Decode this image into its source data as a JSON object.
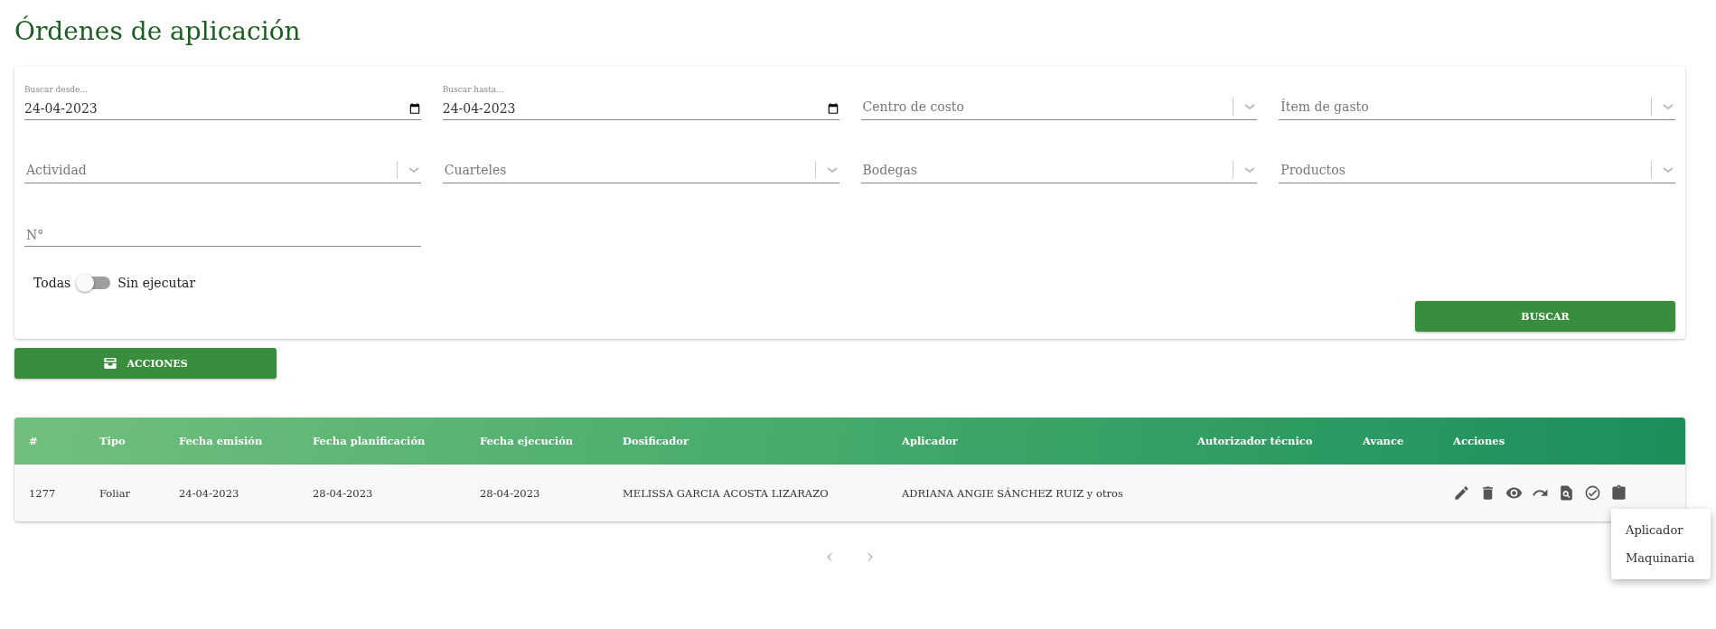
{
  "page_title": "Órdenes de aplicación",
  "filters": [
    {
      "kind": "date",
      "label": "Buscar desde...",
      "value": "24-04-2023"
    },
    {
      "kind": "date",
      "label": "Buscar hasta...",
      "value": "24-04-2023"
    },
    {
      "kind": "select",
      "placeholder": "Centro de costo"
    },
    {
      "kind": "select",
      "placeholder": "Ítem de gasto"
    },
    {
      "kind": "select",
      "placeholder": "Actividad"
    },
    {
      "kind": "select",
      "placeholder": "Cuarteles"
    },
    {
      "kind": "select",
      "placeholder": "Bodegas"
    },
    {
      "kind": "select",
      "placeholder": "Productos"
    },
    {
      "kind": "text",
      "placeholder": "N°"
    }
  ],
  "toggle": {
    "left_label": "Todas",
    "right_label": "Sin ejecutar",
    "on": false
  },
  "search_button": "BUSCAR",
  "actions_button": "ACCIONES",
  "table": {
    "columns": [
      "#",
      "Tipo",
      "Fecha emisión",
      "Fecha planificación",
      "Fecha ejecución",
      "Dosificador",
      "Aplicador",
      "Autorizador técnico",
      "Avance",
      "Acciones"
    ],
    "rows": [
      {
        "cells": [
          "1277",
          "Foliar",
          "24-04-2023",
          "28-04-2023",
          "28-04-2023",
          "MELISSA GARCIA ACOSTA LIZARAZO",
          "ADRIANA ANGIE SÁNCHEZ RUIZ y otros",
          "",
          ""
        ]
      }
    ]
  },
  "pagination": {
    "prev": {
      "label": "‹",
      "disabled": true
    },
    "next": {
      "label": "›",
      "disabled": true
    }
  },
  "menu": {
    "items": [
      "Aplicador",
      "Maquinaria"
    ]
  }
}
